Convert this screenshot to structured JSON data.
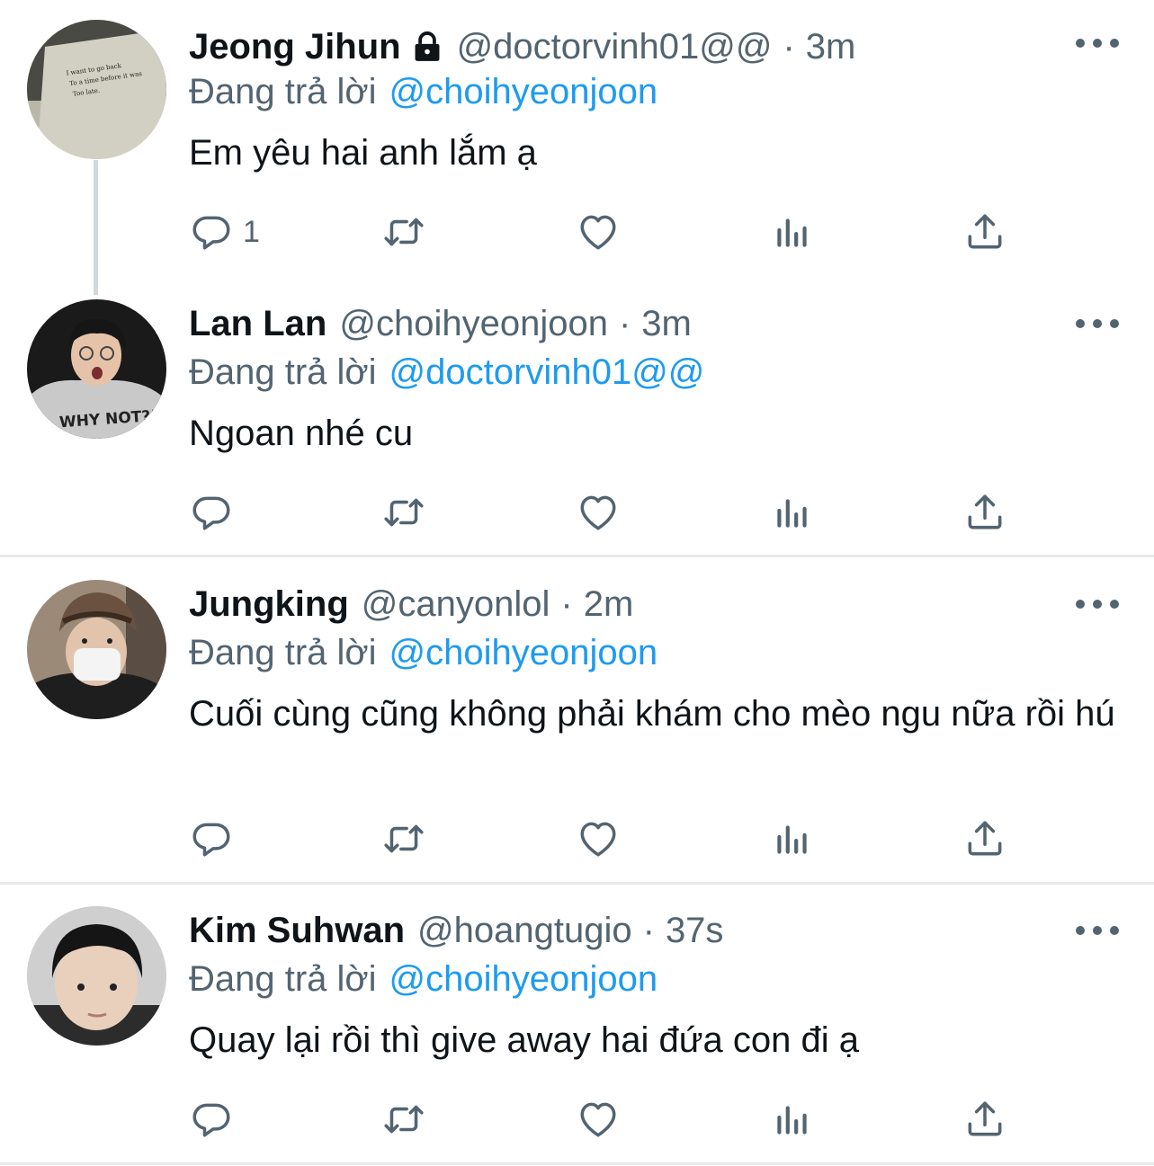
{
  "colors": {
    "accent": "#1d9bf0",
    "secondary_text": "#536471",
    "primary_text": "#0f1419",
    "divider": "#e7e9ea"
  },
  "tweets": [
    {
      "name": "Jeong Jihun",
      "protected": true,
      "handle": "@doctorvinh01@@",
      "dot": "·",
      "time": "3m",
      "reply_prefix": "Đang trả lời",
      "reply_to": "@choihyeonjoon",
      "text": "Em yêu hai anh lắm ạ",
      "reply_count": "1",
      "avatar_text": [
        "I want to go back",
        "To a time before it was",
        "Too late."
      ]
    },
    {
      "name": "Lan Lan",
      "handle": "@choihyeonjoon",
      "dot": "·",
      "time": "3m",
      "reply_prefix": "Đang trả lời",
      "reply_to": "@doctorvinh01@@",
      "text": "Ngoan nhé cu",
      "reply_count": "",
      "avatar_text": [
        "WHY NOT?!"
      ]
    },
    {
      "name": "Jungking",
      "handle": "@canyonlol",
      "dot": "·",
      "time": "2m",
      "reply_prefix": "Đang trả lời",
      "reply_to": "@choihyeonjoon",
      "text": "Cuối cùng cũng không phải khám cho mèo ngu nữa rồi hú",
      "reply_count": ""
    },
    {
      "name": "Kim Suhwan",
      "handle": "@hoangtugio",
      "dot": "·",
      "time": "37s",
      "reply_prefix": "Đang trả lời",
      "reply_to": "@choihyeonjoon",
      "text": "Quay lại rồi thì give away hai đứa con đi ạ",
      "reply_count": ""
    }
  ],
  "icons": [
    "reply-icon",
    "retweet-icon",
    "like-icon",
    "views-icon",
    "share-icon",
    "more-icon",
    "lock-icon"
  ]
}
